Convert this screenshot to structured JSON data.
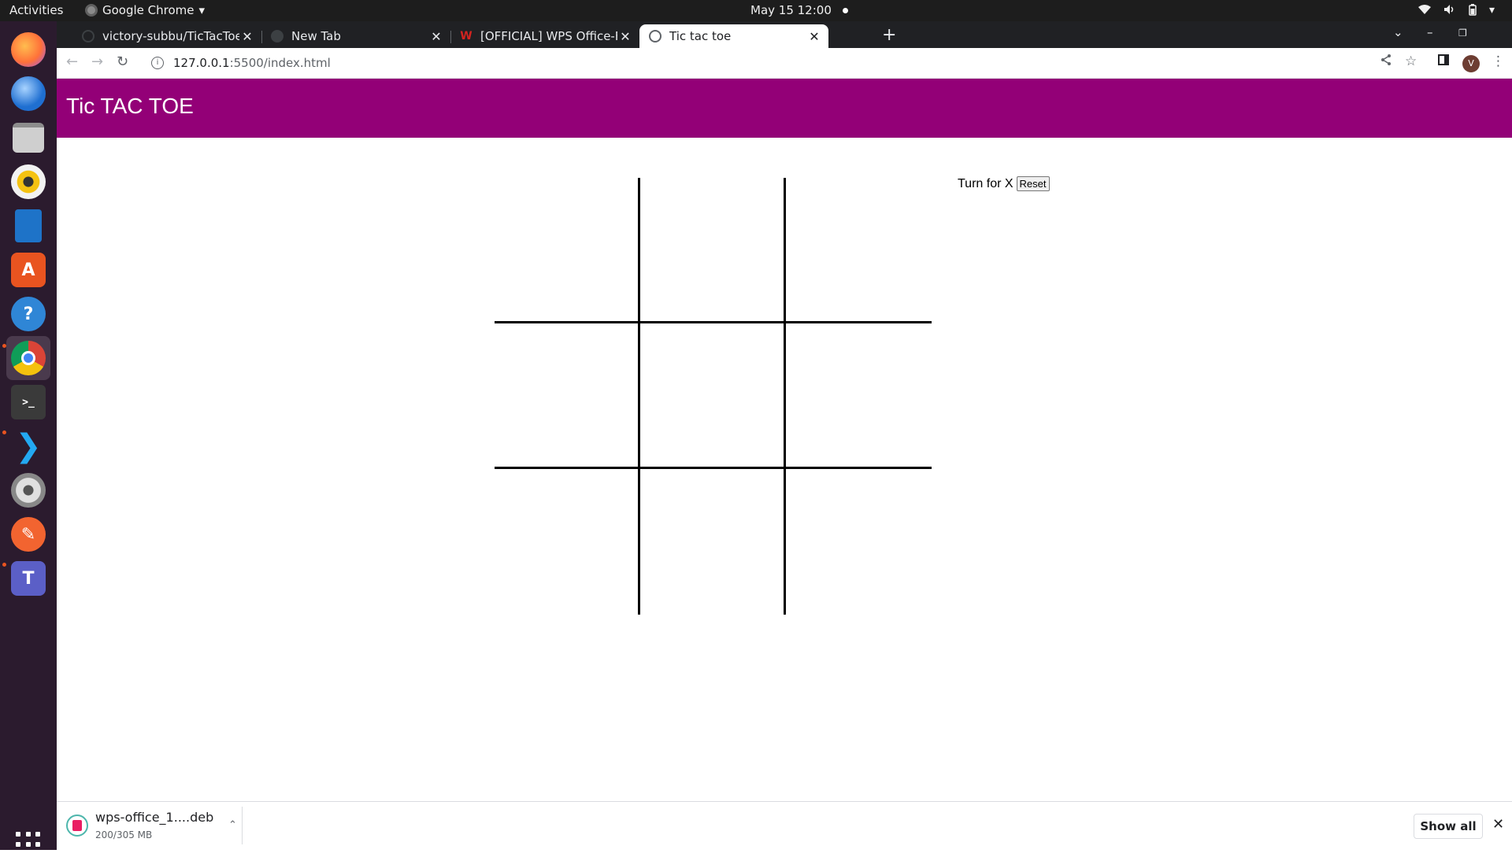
{
  "system": {
    "activities": "Activities",
    "app_name": "Google Chrome",
    "app_menu_arrow": "▾",
    "clock": "May 15  12:00"
  },
  "browser": {
    "tabs": [
      {
        "title": "victory-subbu/TicTacToe",
        "close": "✕"
      },
      {
        "title": "New Tab",
        "close": "✕"
      },
      {
        "title": "[OFFICIAL] WPS Office-Free",
        "close": "✕"
      },
      {
        "title": "Tic tac toe",
        "close": "✕"
      }
    ],
    "url_host": "127.0.0.1",
    "url_path": ":5500/index.html",
    "profile_initial": "V"
  },
  "page": {
    "header_title": "Tic TAC TOE",
    "status_text": "Turn for X",
    "reset_label": "Reset",
    "board": [
      [
        "",
        "",
        ""
      ],
      [
        "",
        "",
        ""
      ],
      [
        "",
        "",
        ""
      ]
    ]
  },
  "downloads": {
    "file_name": "wps-office_1....deb",
    "progress": "200/305 MB",
    "show_all_label": "Show all"
  },
  "colors": {
    "header_bg": "#930077",
    "header_text": "#ffffff",
    "dock_bg": "#2b1b2e",
    "tabstrip_bg": "#202124"
  },
  "dock_icons": [
    "firefox-icon",
    "thunderbird-icon",
    "files-icon",
    "rhythmbox-icon",
    "writer-icon",
    "app-center-icon",
    "help-icon",
    "chrome-icon",
    "terminal-icon",
    "vscode-icon",
    "settings-icon",
    "pen-icon",
    "teams-icon"
  ]
}
